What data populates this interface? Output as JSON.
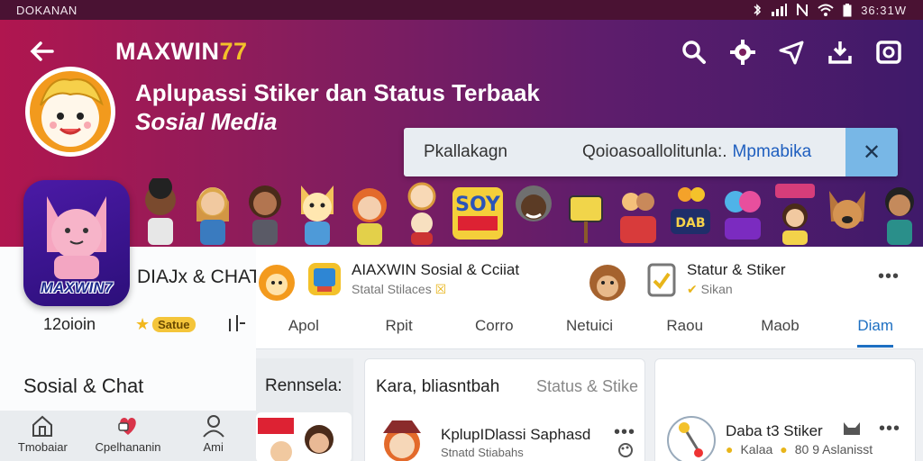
{
  "status_bar": {
    "carrier": "DOKANAN",
    "time": "36:31W",
    "icons": [
      "bluetooth-icon",
      "signal-icon",
      "nfc-icon",
      "wifi-icon",
      "battery-icon"
    ]
  },
  "header": {
    "brand_prefix": "MAXWIN",
    "brand_suffix": "77",
    "headline": "Aplupassi Stiker dan Status Terbaak",
    "subhead": "Sosial Media",
    "toolbar_icons": [
      "search-icon",
      "settings-icon",
      "send-icon",
      "download-icon",
      "camera-icon"
    ]
  },
  "search": {
    "left": "Pkallakagn",
    "middle": "Qoioasoallolitunla:.",
    "link": "Mpmabika"
  },
  "app": {
    "icon_label": "MAXWIN7",
    "name": "DIAJx & CHAT",
    "rating_count": "12oioin",
    "badge": "Satue",
    "section_heading": "Sosial & Chat"
  },
  "bottom_nav": [
    {
      "label": "Tmobaiar",
      "icon": "home-icon"
    },
    {
      "label": "Cpelhananin",
      "icon": "heart-chat-icon"
    },
    {
      "label": "Ami",
      "icon": "profile-icon"
    }
  ],
  "featured": [
    {
      "title": "AIAXWIN Sosial & Cciiat",
      "sub": "Statal Stilaces"
    },
    {
      "title": "Statur & Stiker",
      "sub": "Sikan"
    }
  ],
  "tabs": [
    "Apol",
    "Rpit",
    "Corro",
    "Netuici",
    "Raou",
    "Maob",
    "Diam"
  ],
  "active_tab": 6,
  "cards": {
    "c1_title": "Rennsela:",
    "c2_title": "Kara, bliasntbah",
    "c2_sub": "Status & Stike",
    "c2_item_title": "KplupIDlassi Saphasd",
    "c2_item_sub": "Stnatd Stiabahs",
    "c3_item_title": "Daba t3 Stiker",
    "c3_item_sub": "Kalaa",
    "c3_item_meta": "80 9 Aslanisst"
  },
  "colors": {
    "brand_accent": "#f3c12a",
    "active_tab": "#1d6fc2",
    "badge": "#f4c53a"
  }
}
